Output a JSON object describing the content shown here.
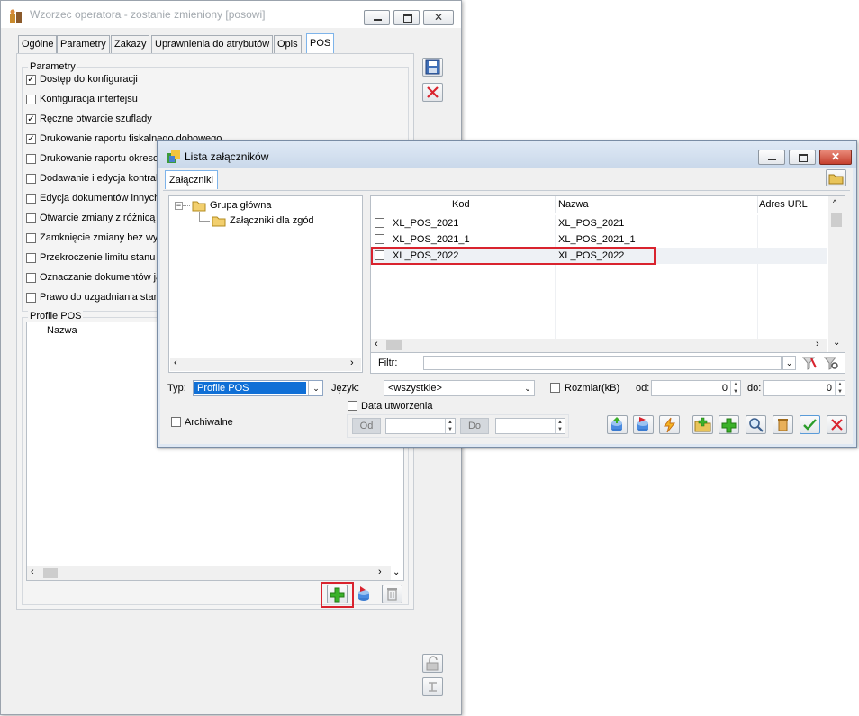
{
  "back_window": {
    "title": "Wzorzec operatora - zostanie zmieniony [posowi]",
    "tabs": [
      "Ogólne",
      "Parametry",
      "Zakazy",
      "Uprawnienia do atrybutów",
      "Opis",
      "POS"
    ],
    "params_group": "Parametry",
    "checkboxes": [
      {
        "label": "Dostęp do konfiguracji",
        "checked": true
      },
      {
        "label": "Konfiguracja interfejsu",
        "checked": false
      },
      {
        "label": "Ręczne otwarcie szuflady",
        "checked": true
      },
      {
        "label": "Drukowanie raportu fiskalnego dobowego",
        "checked": true
      },
      {
        "label": "Drukowanie raportu okresowego",
        "checked": false
      },
      {
        "label": "Dodawanie i edycja kontrahentów",
        "checked": false
      },
      {
        "label": "Edycja dokumentów innych operatorów",
        "checked": false
      },
      {
        "label": "Otwarcie zmiany z różnicą stanu",
        "checked": false
      },
      {
        "label": "Zamknięcie zmiany bez wypłaty",
        "checked": false
      },
      {
        "label": "Przekroczenie limitu stanu kasy",
        "checked": false
      },
      {
        "label": "Oznaczanie dokumentów jako",
        "checked": false
      },
      {
        "label": "Prawo do uzgadniania stanów",
        "checked": false
      }
    ],
    "profiles_group": "Profile POS",
    "profiles_column": "Nazwa"
  },
  "front_window": {
    "title": "Lista załączników",
    "tab": "Załączniki",
    "tree": {
      "root": "Grupa główna",
      "child": "Załączniki dla zgód"
    },
    "list": {
      "columns": [
        "Kod",
        "Nazwa",
        "Adres URL"
      ],
      "rows": [
        {
          "kod": "XL_POS_2021",
          "nazwa": "XL_POS_2021",
          "url": ""
        },
        {
          "kod": "XL_POS_2021_1",
          "nazwa": "XL_POS_2021_1",
          "url": ""
        },
        {
          "kod": "XL_POS_2022",
          "nazwa": "XL_POS_2022",
          "url": ""
        }
      ]
    },
    "filter_label": "Filtr:",
    "filter_value": "",
    "typ_label": "Typ:",
    "typ_value": "Profile POS",
    "jezyk_label": "Język:",
    "jezyk_value": "<wszystkie>",
    "rozmiar_label": "Rozmiar(kB)",
    "od_label": "od:",
    "od_value": "0",
    "do_label": "do:",
    "do_value": "0",
    "data_utworzenia": "Data utworzenia",
    "data_od_label": "Od",
    "data_do_label": "Do",
    "archiwalne": "Archiwalne"
  },
  "colors": {
    "highlight_red": "#d9232e",
    "select_blue": "#0f6fd6",
    "tab_active_border": "#7eb4ea"
  }
}
